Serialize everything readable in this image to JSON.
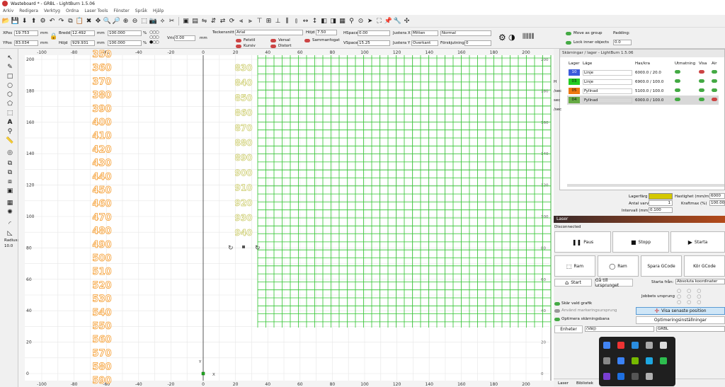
{
  "window": {
    "title": "Wasteboard * - GRBL - LightBurn 1.5.06"
  },
  "menu": [
    "Arkiv",
    "Redigera",
    "Verktyg",
    "Ordna",
    "Laser Tools",
    "Fönster",
    "Språk",
    "Hjälp"
  ],
  "numeric_edits": {
    "xpos_label": "XPos",
    "xpos": "19.753",
    "ypos_label": "YPos",
    "ypos": "83.034",
    "unit": "mm",
    "width_label": "Bredd",
    "width": "12.492",
    "height_label": "Höjd",
    "height": "929.931",
    "scale_w": "100.000",
    "scale_h": "100.000",
    "pct": "%",
    "rotate_label": "Vrid",
    "rotate": "0.00",
    "rotate_unit": "mm"
  },
  "text_options": {
    "font_label": "Teckensnitt",
    "font": "Arial",
    "height_label": "Höjd",
    "height": "7.50",
    "bold": "Fetstil",
    "italic": "Kursiv",
    "upper": "Versal",
    "distort": "Distort",
    "welded": "Sammanfogat",
    "hspace_label": "HSpace",
    "hspace": "0.00",
    "vspace_label": "VSpace",
    "vspace": "15.25",
    "alignx_label": "Justera X",
    "alignx": "Mitten",
    "aligny_label": "Justera Y",
    "aligny": "Överkant",
    "normal": "Normal",
    "offset_label": "Förskjutning",
    "offset": "0"
  },
  "group_opts": {
    "move_as_group": "Move as group",
    "lock_inner": "Lock inner objects",
    "padding_label": "Padding:",
    "padding": "0.0"
  },
  "left_tools": {
    "radius_label": "Radius:",
    "radius": "10.0"
  },
  "canvas": {
    "top_ruler": [
      "-100",
      "-80",
      "-60",
      "-40",
      "-20",
      "0",
      "20",
      "40",
      "60",
      "80",
      "100",
      "120",
      "140",
      "160",
      "180",
      "200",
      "220"
    ],
    "left_ruler": [
      "200",
      "180",
      "160",
      "140",
      "120",
      "100",
      "80",
      "60",
      "40",
      "20",
      "0"
    ],
    "bottom_ruler": [
      "-100",
      "-80",
      "-60",
      "-40",
      "-20",
      "0",
      "20",
      "40",
      "60",
      "80",
      "100",
      "120",
      "140",
      "160",
      "180",
      "200",
      "22"
    ],
    "orange_labels": [
      "350",
      "360",
      "370",
      "380",
      "390",
      "400",
      "410",
      "420",
      "430",
      "440",
      "450",
      "460",
      "470",
      "480",
      "490",
      "500",
      "510",
      "520",
      "530",
      "540",
      "550",
      "560",
      "570",
      "580",
      "590"
    ],
    "yellow_labels": [
      "830",
      "840",
      "850",
      "860",
      "870",
      "880",
      "890",
      "900",
      "910",
      "920",
      "930",
      "940"
    ],
    "origin_x": "X",
    "origin_y": "Y"
  },
  "cuts": {
    "panel_title": "Skärningar / lager - LightBurn 1.5.06",
    "headers": [
      "Lager",
      "Läge",
      "Has/kra",
      "Utmatning",
      "Visa",
      "Air"
    ],
    "rows": [
      {
        "num": "10",
        "mode": "Linje",
        "speed": "6000.0 / 20.0",
        "color": "#3b5bdb",
        "side": "H"
      },
      {
        "num": "03",
        "mode": "Linje",
        "speed": "6900.0 / 100.0",
        "color": "#22cc22",
        "side": "/sec"
      },
      {
        "num": "05",
        "mode": "Fyllnad",
        "speed": "5100.0 / 100.0",
        "color": "#ee7711",
        "side": "sec"
      },
      {
        "num": "04",
        "mode": "Fyllnad",
        "speed": "6000.0 / 100.0",
        "color": "#66aa44",
        "side": "/sec"
      }
    ],
    "layer_color_label": "Lagerfärg",
    "layer_color": "#d4c800",
    "speed_label": "Hastighet (mm/m)",
    "speed": "6000",
    "passes_label": "Antal varv",
    "passes": "1",
    "power_label": "Kraftmax (%)",
    "power": "100.00",
    "interval_label": "Intervall (mm)",
    "interval": "0.100"
  },
  "laser": {
    "title": "Laser",
    "status": "Disconnected",
    "pause": "Paus",
    "stop": "Stopp",
    "start": "Starta",
    "frame1": "Ram",
    "frame2": "Ram",
    "save_gcode": "Spara GCode",
    "run_gcode": "Kör GCode",
    "home": "Start",
    "goto_origin": "Gå till ursprunget",
    "start_from_label": "Starta från:",
    "start_from": "Absoluta koordinater",
    "job_origin_label": "Jobbets ursprung",
    "cut_selected": "Skär vald grafik",
    "use_selection_origin": "Använd markeringsursprung",
    "show_last_pos": "Visa senaste position",
    "optimize_path": "Optimera skärningsbana",
    "optimize_settings": "Optimeringsinställningar",
    "devices": "Enheter",
    "device_select": "(Välj)",
    "device_type": "GRBL"
  },
  "bottom_tabs": [
    "Laser",
    "Bibliotek"
  ]
}
